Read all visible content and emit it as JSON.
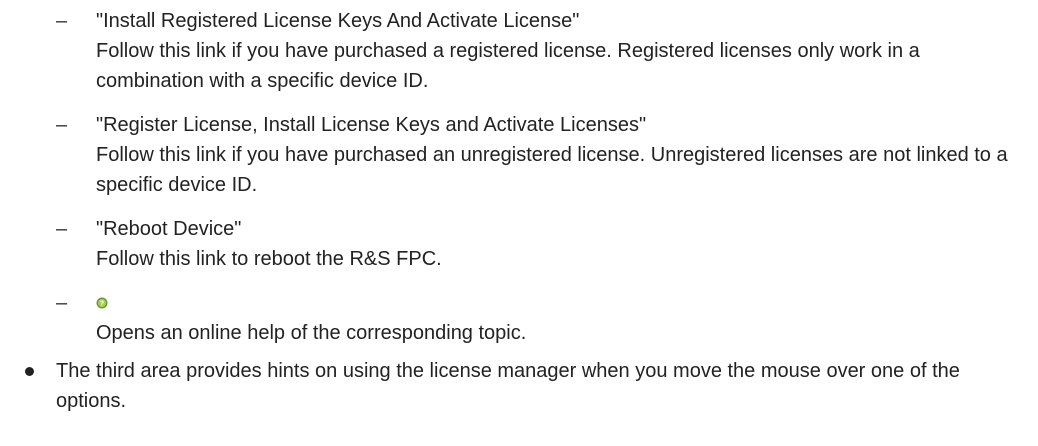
{
  "list": {
    "dash": "–",
    "items": [
      {
        "title": "\"Install Registered License Keys And Activate License\"",
        "description": "Follow this link if you have purchased a registered license. Registered licenses only work in a combination with a specific device ID."
      },
      {
        "title": "\"Register License, Install License Keys and Activate Licenses\"",
        "description": "Follow this link if you have purchased an unregistered license. Unregistered licenses are not linked to a specific device ID."
      },
      {
        "title": "\"Reboot Device\"",
        "description": "Follow this link to reboot the R&S FPC."
      },
      {
        "icon": "help-icon",
        "description": "Opens an online help of the corresponding topic."
      }
    ]
  },
  "bullet": {
    "text": "The third area provides hints on using the license manager when you move the mouse over one of the options."
  },
  "colors": {
    "text": "#222222",
    "icon_green": "#6b9a2e"
  }
}
